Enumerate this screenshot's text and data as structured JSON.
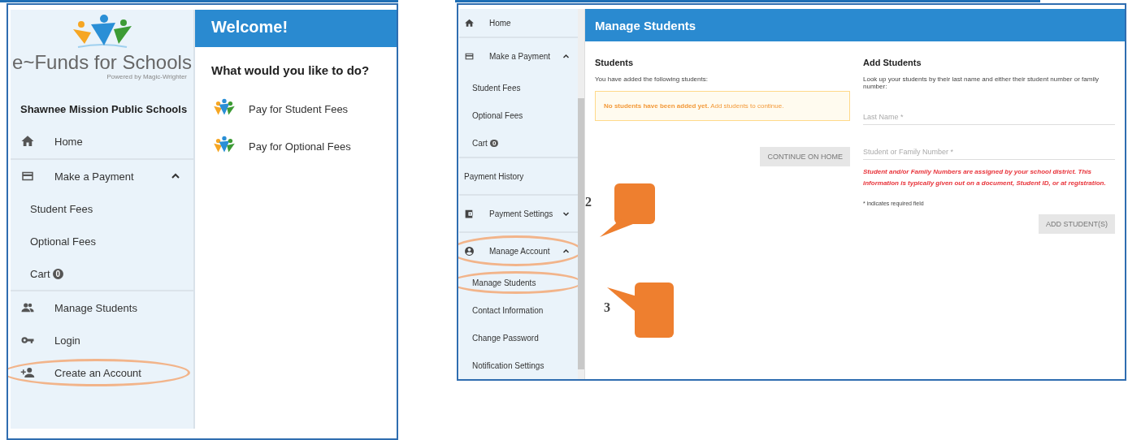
{
  "left_screen": {
    "logo": {
      "name": "e~Funds for Schools",
      "tagline": "Powered by Magic-Wrighter"
    },
    "district": "Shawnee Mission Public Schools",
    "nav": [
      {
        "kind": "top",
        "label": "Home",
        "divider_after": true
      },
      {
        "kind": "top",
        "label": "Make a Payment",
        "expanded": true
      },
      {
        "kind": "sub",
        "label": "Student Fees"
      },
      {
        "kind": "sub",
        "label": "Optional Fees"
      },
      {
        "kind": "sub",
        "label": "Cart",
        "badge": "0",
        "divider_after": true
      },
      {
        "kind": "top",
        "label": "Manage Students"
      },
      {
        "kind": "top",
        "label": "Login"
      },
      {
        "kind": "top",
        "label": "Create an Account",
        "highlighted": true
      }
    ],
    "header": "Welcome!",
    "heading": "What would you like to do?",
    "actions": [
      {
        "label": "Pay for Student Fees"
      },
      {
        "label": "Pay for Optional Fees"
      }
    ]
  },
  "right_screen": {
    "nav": [
      {
        "kind": "top",
        "label": "Home",
        "divider_after": true
      },
      {
        "kind": "top",
        "label": "Make a Payment",
        "expanded": true
      },
      {
        "kind": "sub",
        "label": "Student Fees"
      },
      {
        "kind": "sub",
        "label": "Optional Fees"
      },
      {
        "kind": "sub",
        "label": "Cart",
        "badge": "0",
        "divider_after": true
      },
      {
        "kind": "plain",
        "label": "Payment History",
        "divider_after": true
      },
      {
        "kind": "top",
        "label": "Payment Settings",
        "expanded": false,
        "divider_after": true
      },
      {
        "kind": "top",
        "label": "Manage Account",
        "expanded": true,
        "highlighted": true
      },
      {
        "kind": "sub",
        "label": "Manage Students",
        "highlighted": true
      },
      {
        "kind": "sub",
        "label": "Contact Information"
      },
      {
        "kind": "sub",
        "label": "Change Password"
      },
      {
        "kind": "sub",
        "label": "Notification Settings"
      }
    ],
    "header": "Manage Students",
    "students": {
      "title": "Students",
      "intro": "You have added the following students:",
      "notice": "**No students have been added yet.** Add students to continue.",
      "button": {
        "label": "CONTINUE ON HOME",
        "disabled": true
      }
    },
    "add_students": {
      "title": "Add Students",
      "intro": "Look up your students by their last name and either their student number or family number:",
      "fields": [
        {
          "placeholder": "Last Name *"
        },
        {
          "placeholder": "Student or Family Number *"
        }
      ],
      "help": "Student and/or Family Numbers are assigned by your school district. This information is typically given out on a document, Student ID, or at registration.",
      "required_note": "* indicates required field",
      "button": {
        "label": "ADD STUDENT(S)",
        "disabled": true
      }
    }
  },
  "annotations": [
    {
      "number": "2"
    },
    {
      "number": "3"
    }
  ]
}
